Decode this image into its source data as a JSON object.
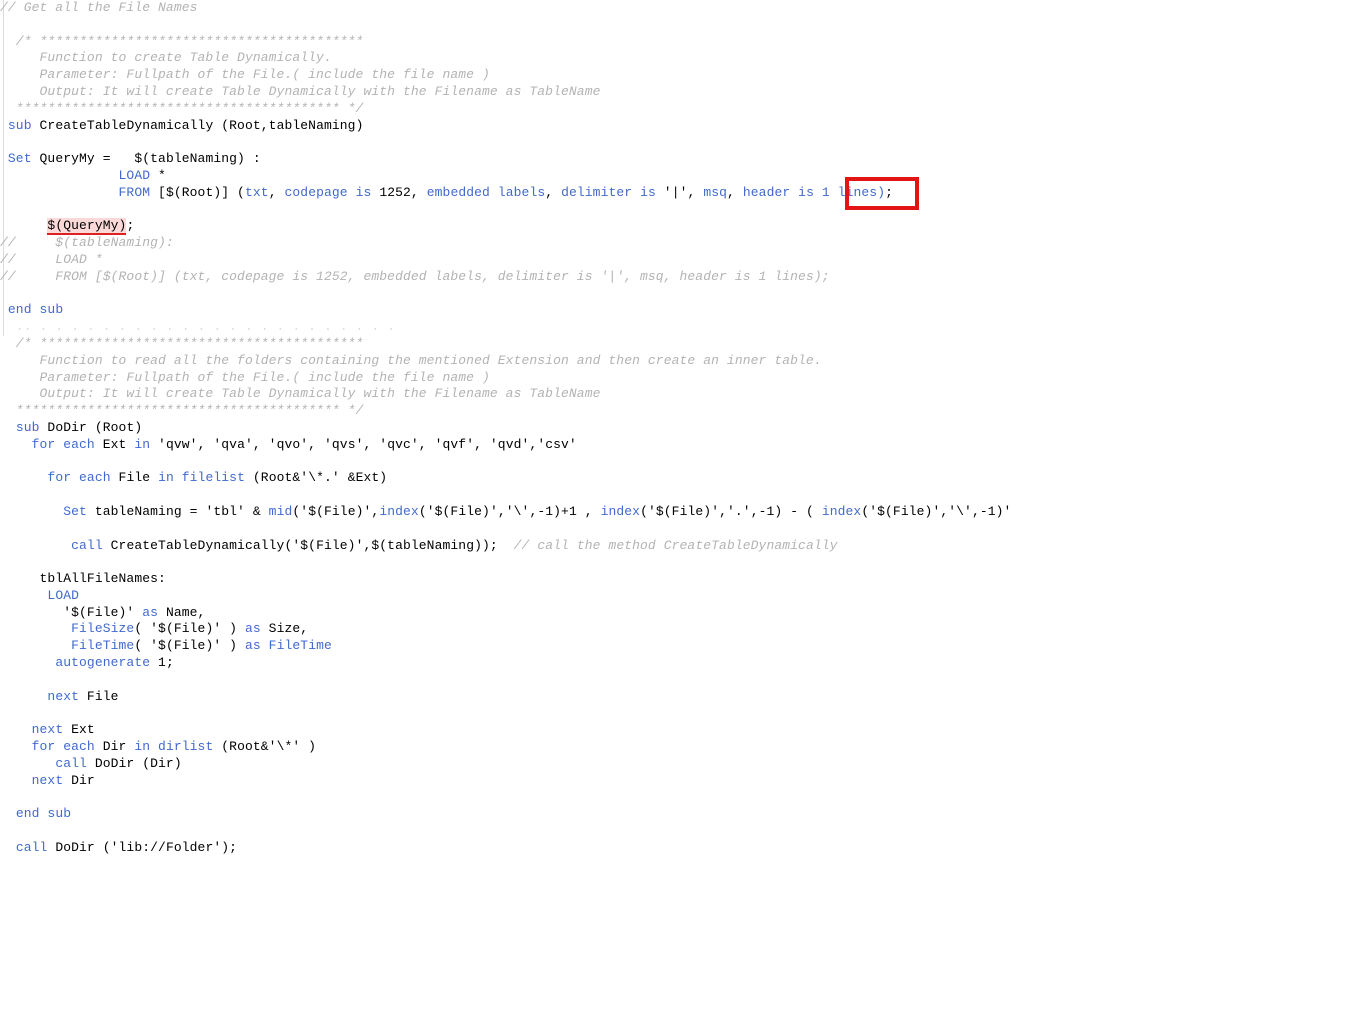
{
  "editor": {
    "language": "qlik-load-script",
    "background_color": "#ffffff",
    "keyword_color": "#4169cd",
    "comment_color": "#b3b3b3",
    "text_color": "#000000"
  },
  "annotation": {
    "type": "rectangle",
    "color": "#e31414",
    "covers_text": "1 lines)"
  },
  "highlight": {
    "token": "$(QueryMy)",
    "background_color": "#fbd9d9",
    "underline_color": "#e02020"
  },
  "code": {
    "l001": "// Get all the File Names",
    "l002": "",
    "l003": "  /* *****************************************",
    "l004": "     Function to create Table Dynamically.",
    "l005": "     Parameter: Fullpath of the File.( include the file name )",
    "l006": "     Output: It will create Table Dynamically with the Filename as TableName",
    "l007": "  ***************************************** */",
    "l008_kw": "sub",
    "l008_rest": " CreateTableDynamically (Root,tableNaming)",
    "l009": "",
    "l010_kw": "Set",
    "l010_rest": " QueryMy =   $(tableNaming) :",
    "l011_kw": "LOAD",
    "l011_rest": " *",
    "l012_from": "FROM",
    "l012_a": " [$(Root)] (",
    "l012_txt": "txt",
    "l012_b": ", ",
    "l012_codepage": "codepage is",
    "l012_c": " 1252, ",
    "l012_embedded": "embedded labels",
    "l012_d": ", ",
    "l012_delimiter": "delimiter is",
    "l012_e": " '|', ",
    "l012_msq": "msq",
    "l012_f": ", ",
    "l012_header": "header is",
    "l012_g": " 1 lines",
    "l012_h": ")",
    "l012_i": ";",
    "l013": "",
    "l014_pre": "      ",
    "l014_hl": "$(QueryMy)",
    "l014_post": ";",
    "l015": "//     $(tableNaming):",
    "l016": "//     LOAD *",
    "l017": "//     FROM [$(Root)] (txt, codepage is 1252, embedded labels, delimiter is '|', msq, header is 1 lines);",
    "l018": "",
    "l019_kw": "end sub",
    "l020": "",
    "l021_ghost": "  .. . . . . . . . . . . . . . . . . . . . . . . .",
    "l022": "  /* *****************************************",
    "l023": "     Function to read all the folders containing the mentioned Extension and then create an inner table.",
    "l024": "     Parameter: Fullpath of the File.( include the file name )",
    "l025": "     Output: It will create Table Dynamically with the Filename as TableName",
    "l026": "  ***************************************** */",
    "l027_kw": "sub",
    "l027_rest": " DoDir (Root)",
    "l028_kw": "for each",
    "l028_mid": " Ext ",
    "l028_in": "in",
    "l028_rest": " 'qvw', 'qva', 'qvo', 'qvs', 'qvc', 'qvf', 'qvd','csv'",
    "l029": "",
    "l030_kw": "for each",
    "l030_mid": " File ",
    "l030_in": "in filelist",
    "l030_rest": " (Root&'\\*.' &Ext)",
    "l031": "",
    "l032_kw": "Set",
    "l032_a": " tableNaming = 'tbl' & ",
    "l032_mid": "mid",
    "l032_b": "('$(File)',",
    "l032_index1": "index",
    "l032_c": "('$(File)','\\',-1)+1 , ",
    "l032_index2": "index",
    "l032_d": "('$(File)','.',-1) - ( ",
    "l032_index3": "index",
    "l032_e": "('$(File)','\\',-1)'",
    "l033": "",
    "l034_kw": "call",
    "l034_rest": " CreateTableDynamically('$(File)',$(tableNaming));  ",
    "l034_cmt": "// call the method CreateTableDynamically",
    "l035": "",
    "l036": "     tblAllFileNames:",
    "l037_kw": "LOAD",
    "l038": "        '$(File)' ",
    "l038_as": "as",
    "l038_rest": " Name,",
    "l039_fn": "FileSize",
    "l039_a": "( '$(File)' ) ",
    "l039_as": "as",
    "l039_rest": " Size,",
    "l040_fn": "FileTime",
    "l040_a": "( '$(File)' ) ",
    "l040_as": "as",
    "l040_rest": " FileTime",
    "l041_kw": "autogenerate",
    "l041_rest": " 1;",
    "l042": "",
    "l043_kw": "next",
    "l043_rest": " File",
    "l044": "",
    "l045_kw": "next",
    "l045_rest": " Ext",
    "l046_kw": "for each",
    "l046_mid": " Dir ",
    "l046_in": "in dirlist",
    "l046_rest": " (Root&'\\*' )",
    "l047_kw": "call",
    "l047_rest": " DoDir (Dir)",
    "l048_kw": "next",
    "l048_rest": " Dir",
    "l049": "",
    "l050_kw": "end sub",
    "l051": "",
    "l052_kw": "call",
    "l052_rest": " DoDir ('lib://Folder');"
  }
}
